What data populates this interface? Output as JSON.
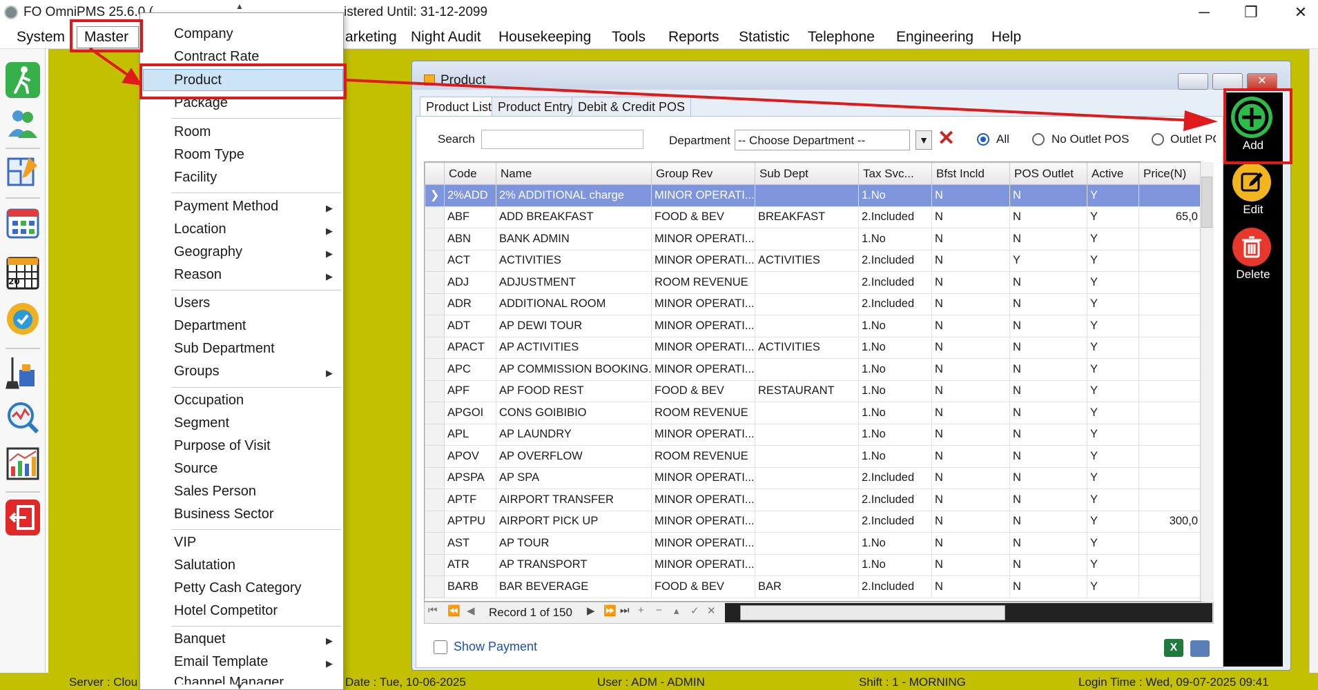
{
  "title_bar": {
    "app_title": "FO OmniPMS 25.6.0.(",
    "registration": "istered Until: 31-12-2099",
    "minimize": "─",
    "restore": "❐",
    "close": "✕"
  },
  "menu_bar": {
    "system": "System",
    "master": "Master",
    "marketing": "arketing",
    "night_audit": "Night Audit",
    "housekeeping": "Housekeeping",
    "tools": "Tools",
    "reports": "Reports",
    "statistic": "Statistic",
    "telephone": "Telephone",
    "engineering": "Engineering",
    "help": "Help"
  },
  "master_menu": {
    "company": "Company",
    "contract_rate": "Contract Rate",
    "product": "Product",
    "package": "Package",
    "room": "Room",
    "room_type": "Room Type",
    "facility": "Facility",
    "payment_method": "Payment Method",
    "location": "Location",
    "geography": "Geography",
    "reason": "Reason",
    "users": "Users",
    "department": "Department",
    "sub_department": "Sub Department",
    "groups": "Groups",
    "occupation": "Occupation",
    "segment": "Segment",
    "purpose_of_visit": "Purpose of Visit",
    "source": "Source",
    "sales_person": "Sales Person",
    "business_sector": "Business Sector",
    "vip": "VIP",
    "salutation": "Salutation",
    "petty_cash_category": "Petty Cash Category",
    "hotel_competitor": "Hotel Competitor",
    "banquet": "Banquet",
    "email_template": "Email Template",
    "channel_manager": "Channel Manager",
    "submenu_arrow": "▶"
  },
  "product_window": {
    "title": "Product",
    "tabs": [
      "Product List",
      "Product Entry",
      "Debit & Credit POS"
    ],
    "search_label": "Search",
    "search_value": "",
    "department_label": "Department",
    "department_value": "-- Choose Department --",
    "radio_all": "All",
    "radio_no_outlet": "No Outlet POS",
    "radio_outlet": "Outlet PC",
    "columns": [
      "Code",
      "Name",
      "Group Rev",
      "Sub Dept",
      "Tax Svc...",
      "Bfst Incld",
      "POS Outlet",
      "Active",
      "Price(N)"
    ],
    "rows": [
      [
        "2%ADD",
        "2% ADDITIONAL charge",
        "MINOR OPERATI...",
        "",
        "1.No",
        "N",
        "N",
        "Y",
        ""
      ],
      [
        "ABF",
        "ADD BREAKFAST",
        "FOOD & BEV",
        "BREAKFAST",
        "2.Included",
        "N",
        "N",
        "Y",
        "65,0"
      ],
      [
        "ABN",
        "BANK ADMIN",
        "MINOR OPERATI...",
        "",
        "1.No",
        "N",
        "N",
        "Y",
        ""
      ],
      [
        "ACT",
        "ACTIVITIES",
        "MINOR OPERATI...",
        "ACTIVITIES",
        "2.Included",
        "N",
        "Y",
        "Y",
        ""
      ],
      [
        "ADJ",
        "ADJUSTMENT",
        "ROOM REVENUE",
        "",
        "2.Included",
        "N",
        "N",
        "Y",
        ""
      ],
      [
        "ADR",
        "ADDITIONAL ROOM",
        "MINOR OPERATI...",
        "",
        "2.Included",
        "N",
        "N",
        "Y",
        ""
      ],
      [
        "ADT",
        "AP DEWI TOUR",
        "MINOR OPERATI...",
        "",
        "1.No",
        "N",
        "N",
        "Y",
        ""
      ],
      [
        "APACT",
        "AP ACTIVITIES",
        "MINOR OPERATI...",
        "ACTIVITIES",
        "1.No",
        "N",
        "N",
        "Y",
        ""
      ],
      [
        "APC",
        "AP COMMISSION BOOKING...",
        "MINOR OPERATI...",
        "",
        "1.No",
        "N",
        "N",
        "Y",
        ""
      ],
      [
        "APF",
        "AP FOOD REST",
        "FOOD & BEV",
        "RESTAURANT",
        "1.No",
        "N",
        "N",
        "Y",
        ""
      ],
      [
        "APGOI",
        "CONS GOIBIBIO",
        "ROOM REVENUE",
        "",
        "1.No",
        "N",
        "N",
        "Y",
        ""
      ],
      [
        "APL",
        "AP LAUNDRY",
        "MINOR OPERATI...",
        "",
        "1.No",
        "N",
        "N",
        "Y",
        ""
      ],
      [
        "APOV",
        "AP OVERFLOW",
        "ROOM REVENUE",
        "",
        "1.No",
        "N",
        "N",
        "Y",
        ""
      ],
      [
        "APSPA",
        "AP SPA",
        "MINOR OPERATI...",
        "",
        "2.Included",
        "N",
        "N",
        "Y",
        ""
      ],
      [
        "APTF",
        "AIRPORT TRANSFER",
        "MINOR OPERATI...",
        "",
        "2.Included",
        "N",
        "N",
        "Y",
        ""
      ],
      [
        "APTPU",
        "AIRPORT PICK UP",
        "MINOR OPERATI...",
        "",
        "2.Included",
        "N",
        "N",
        "Y",
        "300,0"
      ],
      [
        "AST",
        "AP TOUR",
        "MINOR OPERATI...",
        "",
        "1.No",
        "N",
        "N",
        "Y",
        ""
      ],
      [
        "ATR",
        "AP TRANSPORT",
        "MINOR OPERATI...",
        "",
        "1.No",
        "N",
        "N",
        "Y",
        ""
      ],
      [
        "BARB",
        "BAR BEVERAGE",
        "FOOD & BEV",
        "BAR",
        "2.Included",
        "N",
        "N",
        "Y",
        ""
      ]
    ],
    "record_text": "Record 1 of 150",
    "show_payment": "Show Payment",
    "actions": {
      "add": "Add",
      "edit": "Edit",
      "delete": "Delete"
    }
  },
  "status_bar": {
    "server": "Server : Clou",
    "date": "Date : Tue, 10-06-2025",
    "user": "User : ADM - ADMIN",
    "shift": "Shift : 1 - MORNING",
    "login": "Login Time : Wed, 09-07-2025 09:41"
  },
  "colors": {
    "desktop": "#c2c000",
    "annotation_red": "#e01a1a",
    "selected_row": "#7e95dd",
    "add_green": "#2dbb4a",
    "edit_yellow": "#f2b51d",
    "delete_red": "#e8382d"
  }
}
